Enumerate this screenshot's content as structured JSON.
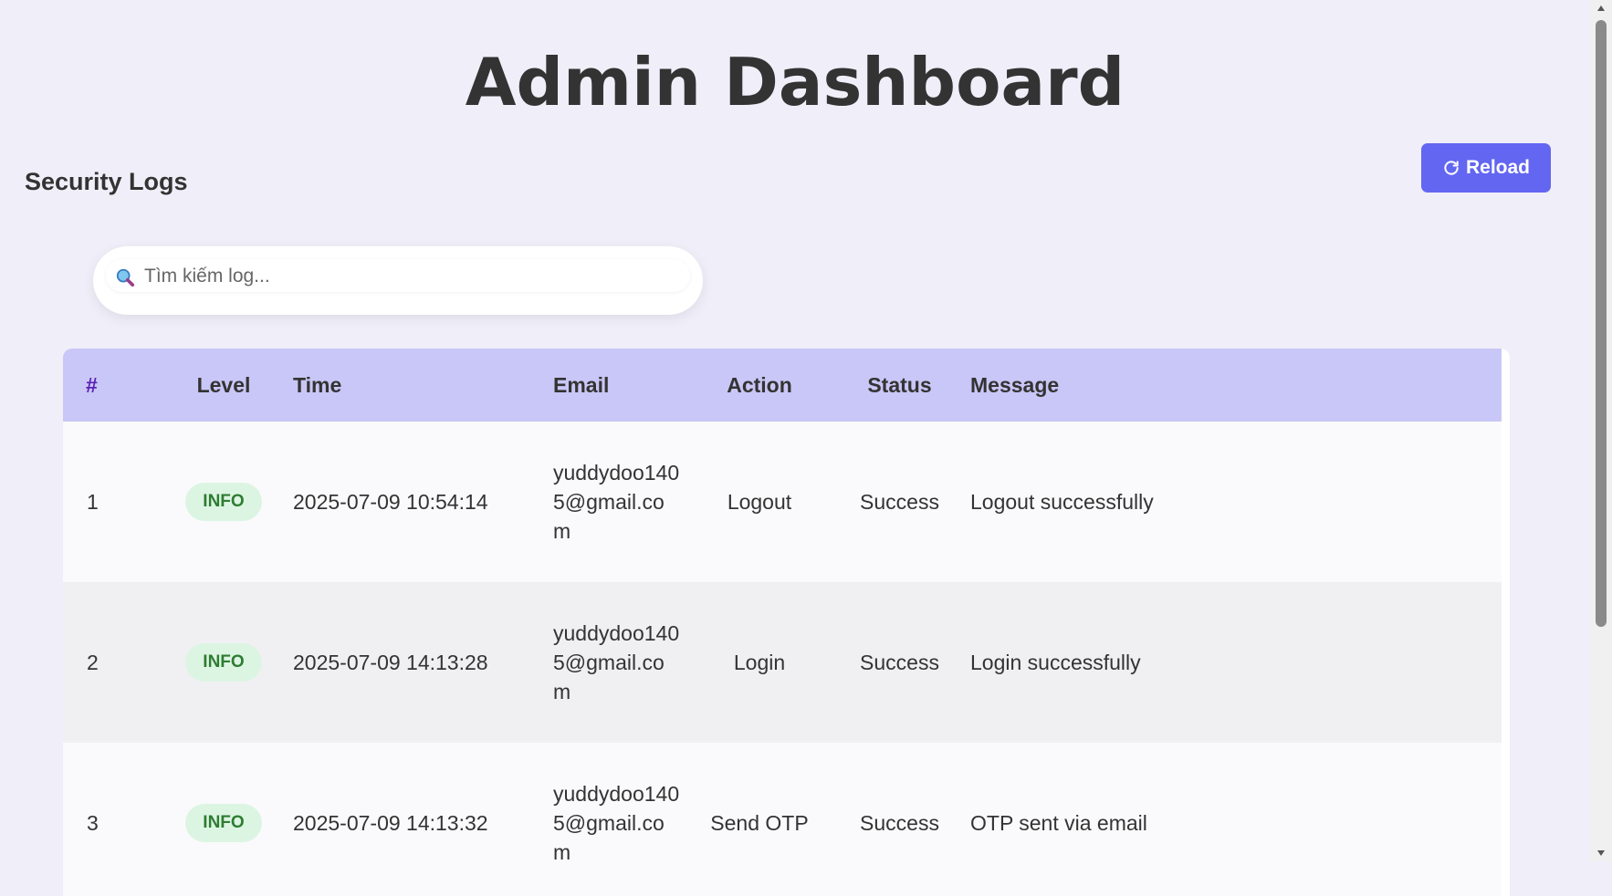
{
  "page": {
    "title": "Admin Dashboard"
  },
  "section": {
    "title": "Security Logs"
  },
  "toolbar": {
    "reload_label": "Reload",
    "reload_icon": "refresh-icon"
  },
  "search": {
    "placeholder": "Tìm kiếm log...",
    "value": "",
    "icon": "search-icon"
  },
  "table": {
    "headers": {
      "num": "#",
      "level": "Level",
      "time": "Time",
      "email": "Email",
      "action": "Action",
      "status": "Status",
      "message": "Message"
    },
    "rows": [
      {
        "num": "1",
        "level": "INFO",
        "time": "2025-07-09 10:54:14",
        "email": "yuddydoo1405@gmail.com",
        "action": "Logout",
        "status": "Success",
        "message": "Logout successfully"
      },
      {
        "num": "2",
        "level": "INFO",
        "time": "2025-07-09 14:13:28",
        "email": "yuddydoo1405@gmail.com",
        "action": "Login",
        "status": "Success",
        "message": "Login successfully"
      },
      {
        "num": "3",
        "level": "INFO",
        "time": "2025-07-09 14:13:32",
        "email": "yuddydoo1405@gmail.com",
        "action": "Send OTP",
        "status": "Success",
        "message": "OTP sent via email"
      }
    ]
  },
  "colors": {
    "background": "#f0eef8",
    "accent": "#6366f1",
    "header_row": "#c9c7f7",
    "badge_bg": "#dcf5e3",
    "badge_text": "#2e7d32"
  }
}
